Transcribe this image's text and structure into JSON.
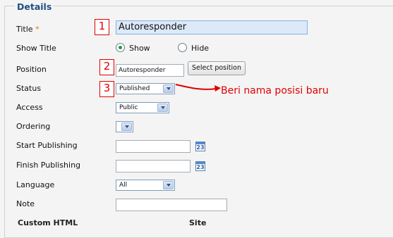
{
  "legend": "Details",
  "fields": {
    "title": {
      "label": "Title",
      "required_mark": "*",
      "value": "Autoresponder"
    },
    "show_title": {
      "label": "Show Title",
      "options": [
        "Show",
        "Hide"
      ],
      "selected": "Show"
    },
    "position": {
      "label": "Position",
      "value": "Autoresponder",
      "button": "Select position"
    },
    "status": {
      "label": "Status",
      "value": "Published"
    },
    "access": {
      "label": "Access",
      "value": "Public"
    },
    "ordering": {
      "label": "Ordering",
      "value": ""
    },
    "start_publishing": {
      "label": "Start Publishing",
      "value": "",
      "icon_text": "23"
    },
    "finish_publishing": {
      "label": "Finish Publishing",
      "value": "",
      "icon_text": "23"
    },
    "language": {
      "label": "Language",
      "value": "All"
    },
    "note": {
      "label": "Note",
      "value": ""
    }
  },
  "markers": [
    "1",
    "2",
    "3"
  ],
  "annotation": "Beri nama posisi baru",
  "bottom": {
    "left": "Custom HTML",
    "right": "Site"
  },
  "colors": {
    "legend": "#1d4f82",
    "annotation": "#e00000",
    "title_input_bg": "#dce9f8"
  }
}
